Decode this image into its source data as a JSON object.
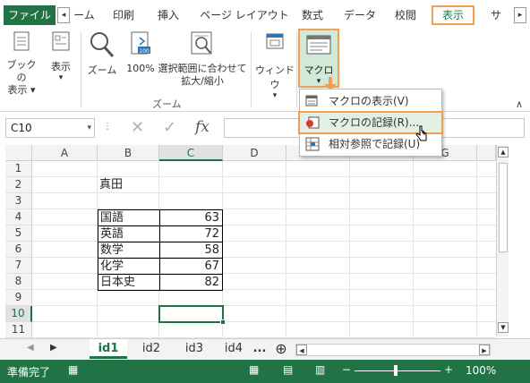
{
  "tabs": {
    "file": "ファイル",
    "home": "ーム",
    "print": "印刷",
    "insert": "挿入",
    "layout": "ページ レイアウト",
    "formulas": "数式",
    "data": "データ",
    "review": "校閲",
    "view": "表示",
    "next": "サ"
  },
  "ribbon": {
    "book_view_line1": "ブックの",
    "book_view_line2": "表示 ▾",
    "show": "表示",
    "zoom": "ズーム",
    "zoom100": "100%",
    "zoom_sel_line1": "選択範囲に合わせて",
    "zoom_sel_line2": "拡大/縮小",
    "zoom_group": "ズーム",
    "window": "ウィンドウ",
    "macro": "マクロ"
  },
  "macro_menu": {
    "items": [
      "マクロの表示(V)",
      "マクロの記録(R)...",
      "相対参照で記録(U)"
    ]
  },
  "formula_bar": {
    "name_box": "C10",
    "fx": "fx",
    "cancel": "✕",
    "enter": "✓"
  },
  "columns": [
    "A",
    "B",
    "C",
    "D",
    "E",
    "F",
    "G"
  ],
  "rows": [
    "1",
    "2",
    "3",
    "4",
    "5",
    "6",
    "7",
    "8",
    "9",
    "10",
    "11"
  ],
  "sheet": {
    "title": "真田",
    "subjects": [
      "国語",
      "英語",
      "数学",
      "化学",
      "日本史"
    ],
    "scores": [
      "63",
      "72",
      "58",
      "67",
      "82"
    ]
  },
  "sheet_tabs": [
    "id1",
    "id2",
    "id3",
    "id4"
  ],
  "sheet_more": "...",
  "status": {
    "ready": "準備完了",
    "zoom": "100%"
  },
  "colors": {
    "accent": "#217346",
    "highlight": "#f0a050"
  }
}
